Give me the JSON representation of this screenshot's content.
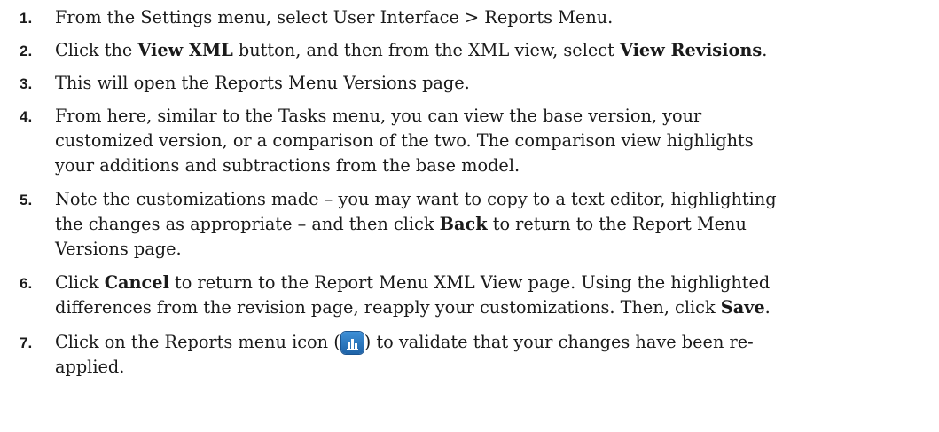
{
  "steps": [
    {
      "number": "1.",
      "lines": [
        [
          {
            "t": "From the Settings menu, select User Interface > Reports Menu."
          }
        ]
      ]
    },
    {
      "number": "2.",
      "lines": [
        [
          {
            "t": "Click the "
          },
          {
            "t": "View XML",
            "b": true
          },
          {
            "t": " button, and then from the XML view, select "
          },
          {
            "t": "View Revisions",
            "b": true
          },
          {
            "t": "."
          }
        ]
      ]
    },
    {
      "number": "3.",
      "lines": [
        [
          {
            "t": "This will open the Reports Menu Versions page."
          }
        ]
      ]
    },
    {
      "number": "4.",
      "lines": [
        [
          {
            "t": "From here, similar to the Tasks menu, you can view the base version, your"
          }
        ],
        [
          {
            "t": "customized version, or a comparison of the two. The comparison view highlights"
          }
        ],
        [
          {
            "t": "your additions and subtractions from the base model."
          }
        ]
      ]
    },
    {
      "number": "5.",
      "lines": [
        [
          {
            "t": "Note the customizations made – you may want to copy to a text editor, highlighting"
          }
        ],
        [
          {
            "t": "the changes as appropriate – and then click "
          },
          {
            "t": "Back",
            "b": true
          },
          {
            "t": " to return to the Report Menu"
          }
        ],
        [
          {
            "t": "Versions page."
          }
        ]
      ]
    },
    {
      "number": "6.",
      "lines": [
        [
          {
            "t": "Click "
          },
          {
            "t": "Cancel",
            "b": true
          },
          {
            "t": " to return to the Report Menu XML View page. Using the highlighted"
          }
        ],
        [
          {
            "t": "differences from the revision page, reapply your customizations. Then, click "
          },
          {
            "t": "Save",
            "b": true
          },
          {
            "t": "."
          }
        ]
      ]
    },
    {
      "number": "7.",
      "lines": [
        [
          {
            "t": "Click on the Reports menu icon ("
          },
          {
            "icon": "reports-menu-icon"
          },
          {
            "t": ") to validate that your changes have been re-"
          }
        ],
        [
          {
            "t": "applied."
          }
        ]
      ]
    }
  ],
  "colors": {
    "text": "#1a1a1a",
    "icon_background": "#2f7fc8"
  }
}
